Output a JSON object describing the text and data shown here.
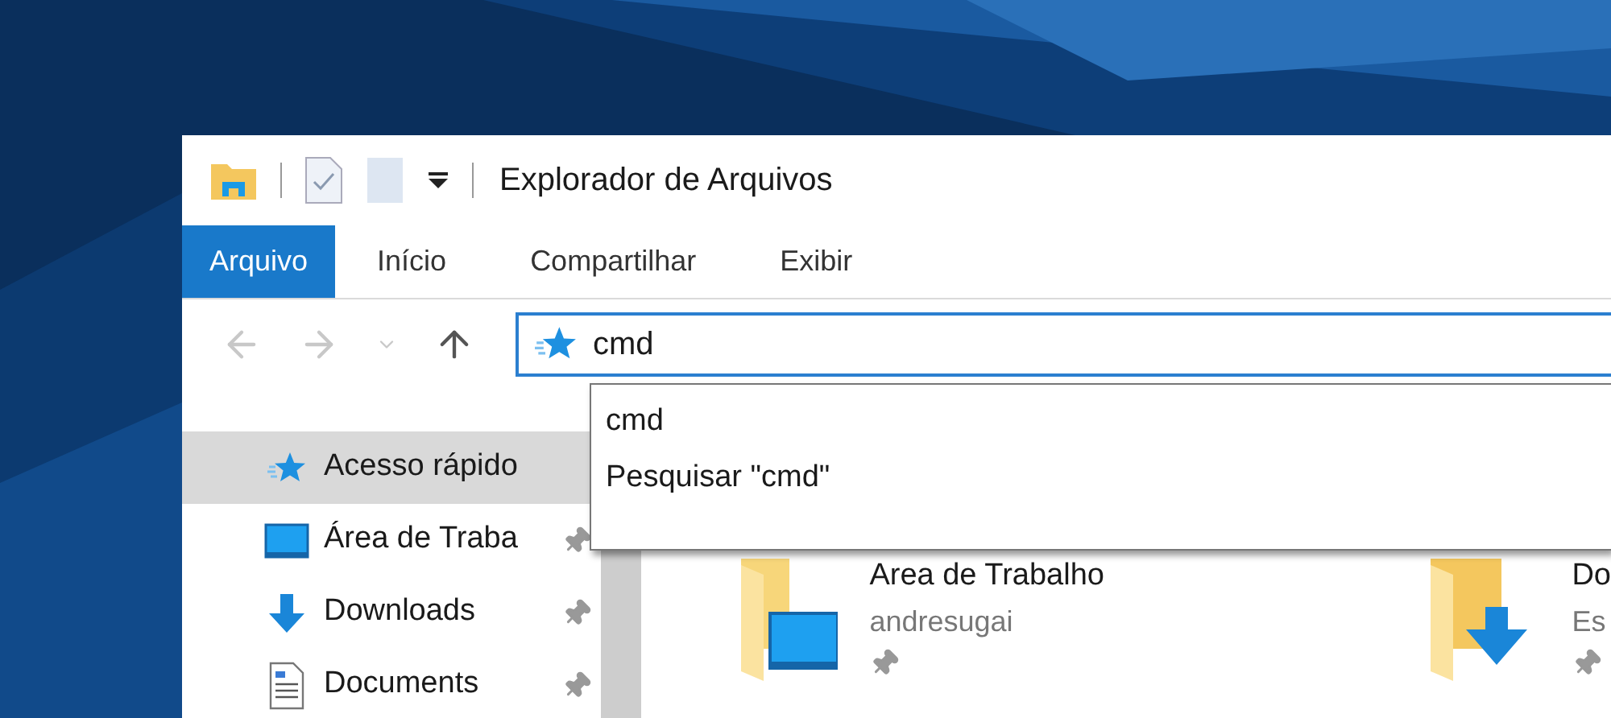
{
  "window": {
    "title": "Explorador de Arquivos"
  },
  "ribbon_tabs": [
    {
      "label": "Arquivo",
      "selected": true
    },
    {
      "label": "Início",
      "selected": false
    },
    {
      "label": "Compartilhar",
      "selected": false
    },
    {
      "label": "Exibir",
      "selected": false
    }
  ],
  "address_bar": {
    "value": "cmd"
  },
  "autocomplete": [
    "cmd",
    "Pesquisar \"cmd\""
  ],
  "sidebar": {
    "items": [
      {
        "label": "Acesso rápido",
        "kind": "star",
        "selected": true,
        "pinned": false
      },
      {
        "label": "Área de Traba",
        "kind": "desktop",
        "selected": false,
        "pinned": true
      },
      {
        "label": "Downloads",
        "kind": "downloads",
        "selected": false,
        "pinned": true
      },
      {
        "label": "Documents",
        "kind": "documents",
        "selected": false,
        "pinned": true
      }
    ]
  },
  "content": {
    "items": [
      {
        "title": "Area de Trabalho",
        "subtitle": "andresugai",
        "kind": "desktop",
        "pinned": true
      },
      {
        "title": "Do",
        "subtitle": "Es",
        "kind": "downloads",
        "pinned": true
      }
    ]
  }
}
